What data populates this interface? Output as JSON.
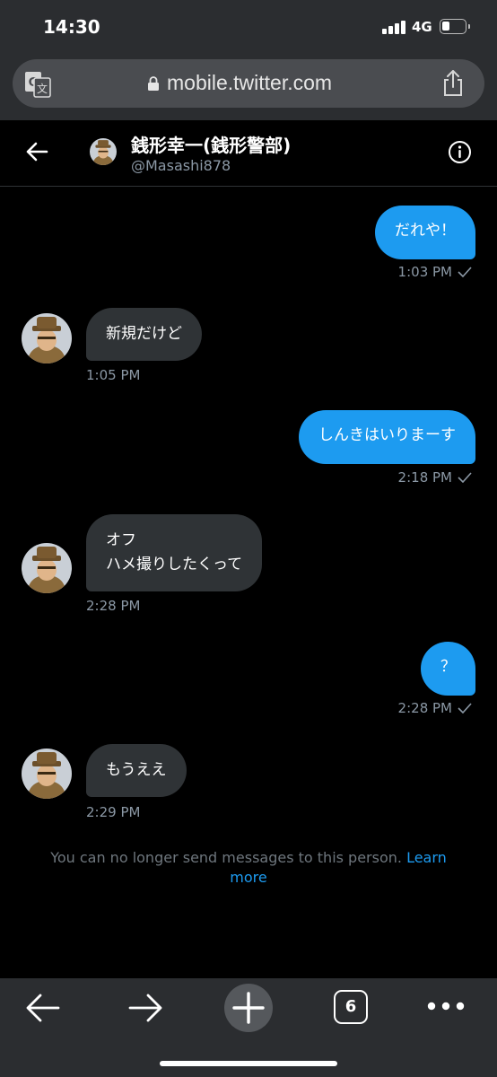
{
  "status_bar": {
    "time": "14:30",
    "network": "4G"
  },
  "browser": {
    "url": "mobile.twitter.com"
  },
  "conversation": {
    "name": "銭形幸一(銭形警部)",
    "handle": "@Masashi878"
  },
  "messages": [
    {
      "direction": "out",
      "text": "だれや！",
      "time": "1:03 PM"
    },
    {
      "direction": "in",
      "text": "新規だけど",
      "time": "1:05 PM"
    },
    {
      "direction": "out",
      "text": "しんきはいりまーす",
      "time": "2:18 PM"
    },
    {
      "direction": "in",
      "text": "オフ\nハメ撮りしたくって",
      "time": "2:28 PM"
    },
    {
      "direction": "out",
      "text": "？",
      "time": "2:28 PM"
    },
    {
      "direction": "in",
      "text": "もうええ",
      "time": "2:29 PM"
    }
  ],
  "notice": {
    "text": "You can no longer send messages to this person.",
    "link": "Learn more"
  },
  "toolbar": {
    "tab_count": "6"
  },
  "colors": {
    "accent": "#1d9bf0",
    "incoming_bubble": "#2f3336",
    "background": "#000000",
    "chrome": "#2b2d30"
  },
  "icons": [
    "translate-icon",
    "lock-icon",
    "share-icon",
    "back-arrow-icon",
    "info-icon",
    "check-icon",
    "forward-arrow-icon",
    "new-tab-icon",
    "tabs-icon",
    "more-icon"
  ]
}
